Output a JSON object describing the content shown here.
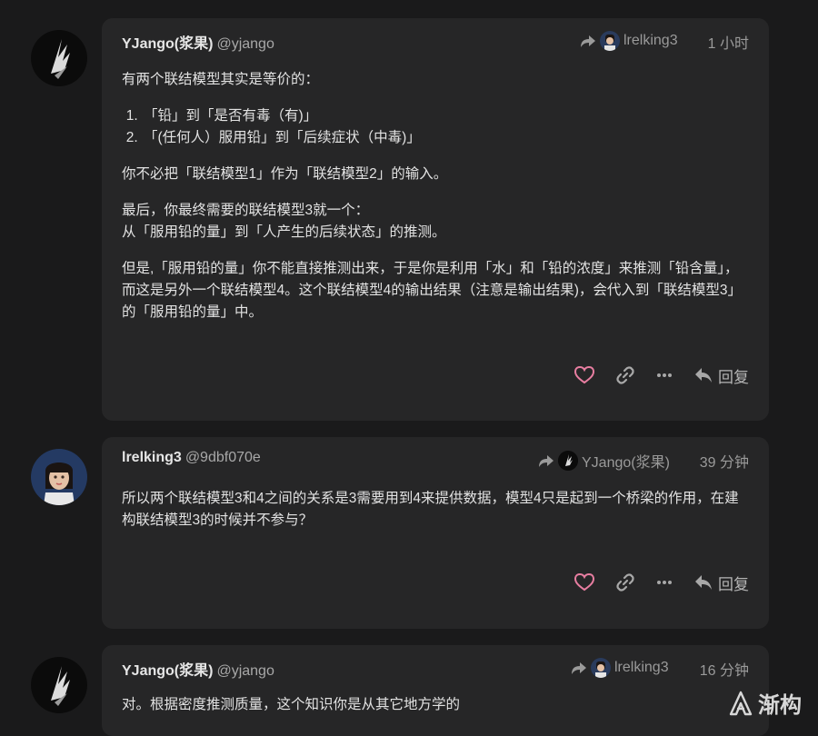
{
  "posts": [
    {
      "author": "YJango(浆果)",
      "handle": "@yjango",
      "reply_to": "lrelking3",
      "time": "1 小时",
      "body": {
        "p1": "有两个联结模型其实是等价的：",
        "list": [
          "「铅」到「是否有毒（有)」",
          "「(任何人）服用铅」到「后续症状（中毒)」"
        ],
        "p2": "你不必把「联结模型1」作为「联结模型2」的输入。",
        "p3_line1": "最后，你最终需要的联结模型3就一个：",
        "p3_line2": "从「服用铅的量」到「人产生的后续状态」的推测。",
        "p4": "但是,「服用铅的量」你不能直接推测出来，于是你是利用「水」和「铅的浓度」来推测「铅含量」，而这是另外一个联结模型4。这个联结模型4的输出结果（注意是输出结果)，会代入到「联结模型3」的「服用铅的量」中。"
      },
      "reply_label": "回复"
    },
    {
      "author": "lrelking3",
      "handle": "@9dbf070e",
      "reply_to": "YJango(浆果)",
      "time": "39 分钟",
      "body": {
        "p1": "所以两个联结模型3和4之间的关系是3需要用到4来提供数据，模型4只是起到一个桥梁的作用，在建构联结模型3的时候并不参与？"
      },
      "reply_label": "回复"
    },
    {
      "author": "YJango(浆果)",
      "handle": "@yjango",
      "reply_to": "lrelking3",
      "time": "16 分钟",
      "body": {
        "p1": "对。根据密度推测质量，这个知识你是从其它地方学的"
      }
    }
  ],
  "watermark": {
    "text": "渐构"
  },
  "icons": {
    "heart": "heart-icon",
    "link": "link-icon",
    "more": "more-icon",
    "reply": "reply-icon",
    "share": "reply-to-arrow-icon"
  },
  "colors": {
    "background": "#1a1a1b",
    "card": "#262627",
    "heart": "#e87ea1",
    "muted": "#9a9a9a"
  }
}
